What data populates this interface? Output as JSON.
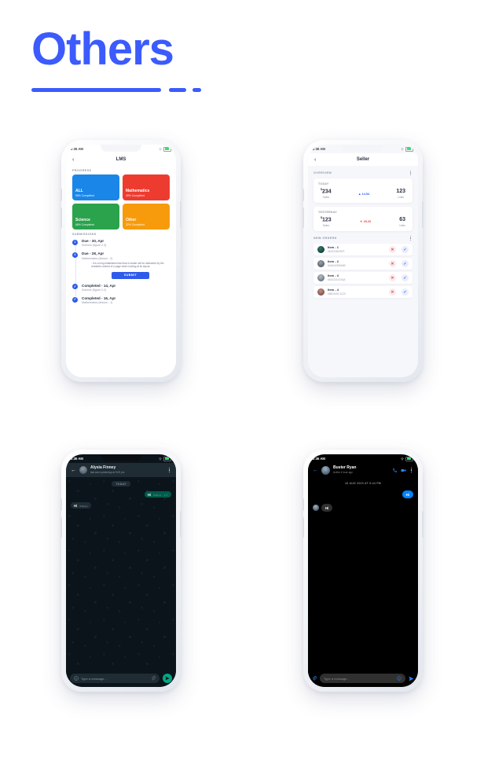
{
  "page": {
    "title": "Others"
  },
  "status_bar": {
    "time": "2:36 AM"
  },
  "phone_lms": {
    "nav": {
      "back_icon": "chevron-left-icon",
      "title": "LMS"
    },
    "progress_label": "PROGRESS",
    "cards": [
      {
        "title": "ALL",
        "subtitle": "58% Completed",
        "color": "#1a86e8"
      },
      {
        "title": "Mathematics",
        "subtitle": "45% Completed",
        "color": "#ee3b2f"
      },
      {
        "title": "Science",
        "subtitle": "68% Completed",
        "color": "#2ba24c"
      },
      {
        "title": "Other",
        "subtitle": "32% Completed",
        "color": "#f79b0d"
      }
    ],
    "submissions_label": "SUBMISSIONS",
    "submissions": [
      {
        "badge": "1",
        "title": "Due - 30, Apr",
        "subtitle": "Science (figure 2.3)",
        "state": "due"
      },
      {
        "badge": "2",
        "title": "Due - 28, Apr",
        "subtitle": "Mathematics (lesson - 2)",
        "state": "due-expanded",
        "body": "- It is a long established fact that a reader will be distracted by the readable content of a page when looking at its layout.",
        "submit_label": "SUBMIT"
      },
      {
        "badge": "✓",
        "title": "Completed - 14, Apr",
        "subtitle": "Science (figure 2.2)",
        "state": "completed"
      },
      {
        "badge": "✓",
        "title": "Completed - 16, Apr",
        "subtitle": "Mathematics (lesson - 1)",
        "state": "completed"
      }
    ]
  },
  "phone_seller": {
    "nav": {
      "back_icon": "chevron-left-icon",
      "title": "Seller"
    },
    "overview_label": "OVERVIEW",
    "stats": [
      {
        "period": "TODAY",
        "sales_currency": "$",
        "sales": "234",
        "sales_label": "Sales",
        "delta": "14.54",
        "delta_dir": "up",
        "delta_color": "#2f5bea",
        "units": "123",
        "units_label": "Units"
      },
      {
        "period": "YESTERDAY",
        "sales_currency": "$",
        "sales": "123",
        "sales_label": "Sales",
        "delta": "25.20",
        "delta_dir": "down",
        "delta_color": "#e8414a",
        "units": "63",
        "units_label": "Units"
      }
    ],
    "new_orders_label": "NEW ORDERS",
    "orders": [
      {
        "name": "Item - 1",
        "id": "#510024525F2",
        "avatar": "#15314f"
      },
      {
        "name": "Item - 2",
        "id": "#4A51A356A5B",
        "avatar": "#6d7c8c"
      },
      {
        "name": "Item - 3",
        "id": "#510221XZX6A",
        "avatar": "#8b99a6"
      },
      {
        "name": "Item - 4",
        "id": "#55D105C1Z2X",
        "avatar": "#8a5a5e"
      }
    ],
    "actions": {
      "reject_icon": "close-icon",
      "accept_icon": "check-icon",
      "reject_label": "✕",
      "accept_label": "✓"
    }
  },
  "phone_whatsapp": {
    "nav": {
      "back_icon": "arrow-left-icon",
      "name": "Alysia Finney",
      "status": "last seen yesterday at 9:09 pm",
      "menu_icon": "kebab-menu-icon"
    },
    "day_divider": "TODAY",
    "messages": [
      {
        "text": "Hi",
        "time": "8:48 pm",
        "side": "out",
        "ticks": "✓✓"
      },
      {
        "text": "Hi",
        "time": "8:48 pm",
        "side": "in"
      }
    ],
    "input": {
      "emoji_icon": "emoji-icon",
      "placeholder": "Type a message...",
      "attach_icon": "paperclip-icon",
      "send_icon": "send-icon"
    }
  },
  "phone_messenger": {
    "nav": {
      "back_icon": "arrow-left-icon",
      "name": "Buster Ryan",
      "status": "Active 4 hour ago",
      "call_icon": "phone-icon",
      "video_icon": "video-icon",
      "menu_icon": "kebab-menu-icon"
    },
    "date_divider": "16 AUG 2020 AT 9:44 PM",
    "messages": [
      {
        "text": "Hi",
        "side": "out"
      },
      {
        "text": "Hi",
        "side": "in"
      }
    ],
    "input": {
      "attach_icon": "paperclip-icon",
      "placeholder": "Type a message...",
      "emoji_icon": "emoji-icon",
      "send_icon": "send-icon"
    }
  }
}
